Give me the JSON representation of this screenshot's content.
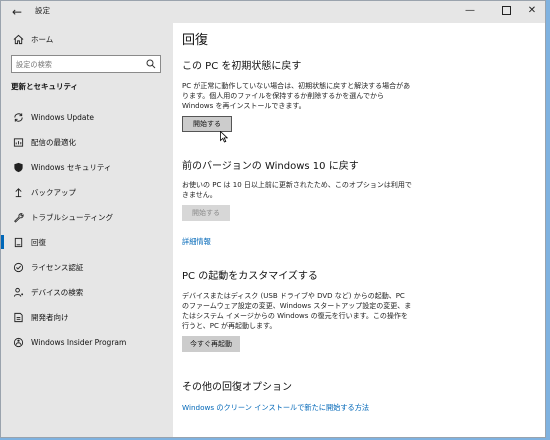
{
  "window": {
    "title": "設定"
  },
  "sidebar": {
    "home": "ホーム",
    "search_placeholder": "設定の検索",
    "section_title": "更新とセキュリティ",
    "items": [
      {
        "label": "Windows Update",
        "icon": "sync-icon"
      },
      {
        "label": "配信の最適化",
        "icon": "delivery-optimization-icon"
      },
      {
        "label": "Windows セキュリティ",
        "icon": "shield-icon"
      },
      {
        "label": "バックアップ",
        "icon": "backup-icon"
      },
      {
        "label": "トラブルシューティング",
        "icon": "wrench-icon"
      },
      {
        "label": "回復",
        "icon": "recovery-icon",
        "active": true
      },
      {
        "label": "ライセンス認証",
        "icon": "check-circle-icon"
      },
      {
        "label": "デバイスの検索",
        "icon": "person-location-icon"
      },
      {
        "label": "開発者向け",
        "icon": "developer-icon"
      },
      {
        "label": "Windows Insider Program",
        "icon": "insider-icon"
      }
    ]
  },
  "main": {
    "title": "回復",
    "reset": {
      "heading": "この PC を初期状態に戻す",
      "desc": "PC が正常に動作していない場合は、初期状態に戻すと解決する場合があります。個人用のファイルを保持するか削除するかを選んでから Windows を再インストールできます。",
      "button": "開始する"
    },
    "goback": {
      "heading": "前のバージョンの Windows 10 に戻す",
      "desc": "お使いの PC は 10 日以上前に更新されたため、このオプションは利用できません。",
      "button": "開始する",
      "link": "詳細情報"
    },
    "advanced": {
      "heading": "PC の起動をカスタマイズする",
      "desc": "デバイスまたはディスク (USB ドライブや DVD など) からの起動、PC のファームウェア設定の変更、Windows スタートアップ設定の変更、またはシステム イメージからの Windows の復元を行います。この操作を行うと、PC が再起動します。",
      "button": "今すぐ再起動"
    },
    "more": {
      "heading": "その他の回復オプション",
      "link": "Windows のクリーン インストールで新たに開始する方法"
    }
  },
  "colors": {
    "accent": "#0067b8",
    "sidebar_bg": "#e6e6e6",
    "desktop": "#7fb2e0"
  }
}
